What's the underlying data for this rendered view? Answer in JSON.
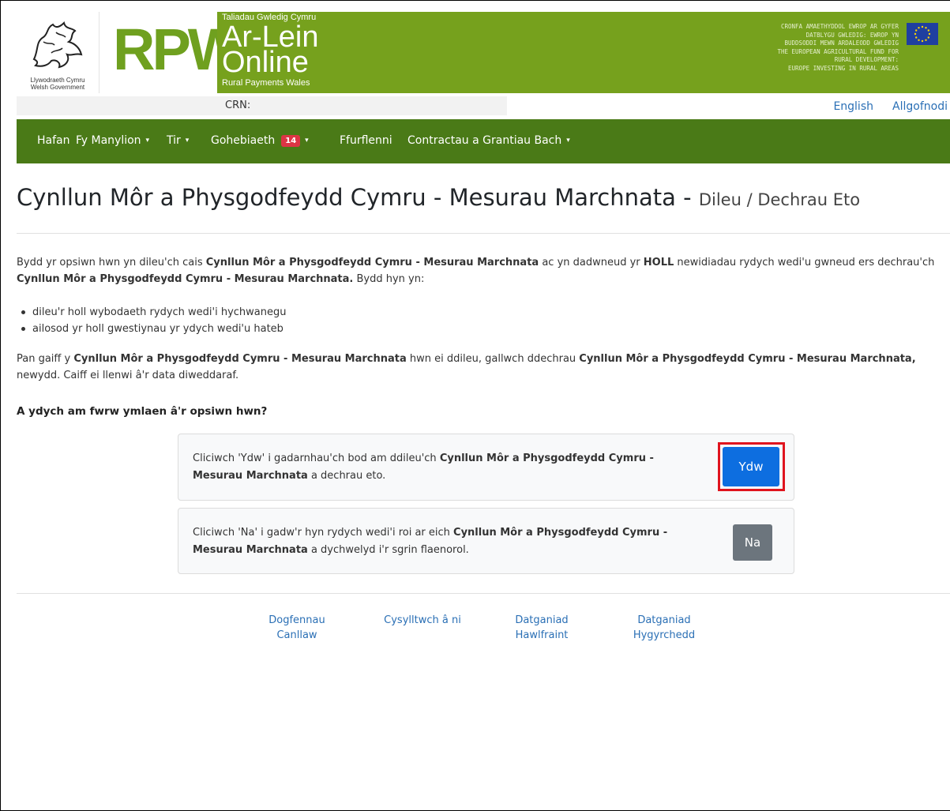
{
  "header": {
    "gov_logo_welsh": "Llywodraeth Cymru",
    "gov_logo_english": "Welsh Government",
    "rpw_logo_text": "RPW",
    "band_small": "Taliadau Gwledig Cymru",
    "band_big_line1": "Ar-Lein",
    "band_big_line2": "Online",
    "band_sub": "Rural Payments Wales",
    "eu_lines": [
      "CRONFA AMAETHYDDOL EWROP AR GYFER",
      "DATBLYGU GWLEDIG: EWROP YN",
      "BUDDSODDI MEWN ARDALEODD GWLEDIG",
      "THE EUROPEAN AGRICULTURAL FUND FOR",
      "RURAL DEVELOPMENT:",
      "EUROPE INVESTING IN RURAL AREAS"
    ],
    "crn_label": "CRN:",
    "lang_link": "English",
    "logout_link": "Allgofnodi"
  },
  "nav": {
    "items": [
      {
        "label": "Hafan"
      },
      {
        "label": "Fy Manylion",
        "caret": "▾"
      },
      {
        "label": "Tir",
        "caret": "▾"
      },
      {
        "label": "Gohebiaeth",
        "badge": "14",
        "caret": "▾"
      },
      {
        "label": "Ffurflenni"
      },
      {
        "label": "Contractau a Grantiau Bach",
        "caret": "▾"
      }
    ]
  },
  "page": {
    "title_main": "Cynllun Môr a Physgodfeydd Cymru - Mesurau Marchnata - ",
    "title_sub": "Dileu / Dechrau Eto",
    "scheme_name": "Cynllun Môr a Physgodfeydd Cymru - Mesurau Marchnata",
    "intro_1": "Bydd yr opsiwn hwn yn dileu'ch cais ",
    "intro_2": " ac yn dadwneud yr ",
    "intro_holl": "HOLL",
    "intro_3": " newidiadau rydych wedi'u gwneud ers dechrau'ch ",
    "intro_scheme_end": "Cynllun Môr a Physgodfeydd Cymru - Mesurau Marchnata.",
    "intro_4": " Bydd hyn yn:",
    "bullets": [
      "dileu'r holl wybodaeth rydych wedi'i hychwanegu",
      "ailosod yr holl gwestiynau yr ydych wedi'u hateb"
    ],
    "after_1": "Pan gaiff y ",
    "after_2": " hwn ei ddileu, gallwch ddechrau ",
    "after_scheme_end": "Cynllun Môr a Physgodfeydd Cymru - Mesurau Marchnata,",
    "after_3": " newydd. Caiff ei llenwi â'r data diweddaraf.",
    "question": "A ydych am fwrw ymlaen â'r opsiwn hwn?",
    "yes_text_1": "Cliciwch 'Ydw' i gadarnhau'ch bod am ddileu'ch ",
    "yes_text_scheme": "Cynllun Môr a Physgodfeydd Cymru - Mesurau Marchnata",
    "yes_text_2": " a dechrau eto.",
    "yes_button": "Ydw",
    "no_text_1": "Cliciwch 'Na' i gadw'r hyn rydych wedi'i roi ar eich ",
    "no_text_scheme": "Cynllun Môr a Physgodfeydd Cymru - Mesurau Marchnata",
    "no_text_2": " a dychwelyd i'r sgrin flaenorol.",
    "no_button": "Na"
  },
  "footer": {
    "links": [
      {
        "line1": "Dogfennau",
        "line2": "Canllaw"
      },
      {
        "line1": "Cysylltwch â ni",
        "line2": ""
      },
      {
        "line1": "Datganiad",
        "line2": "Hawlfraint"
      },
      {
        "line1": "Datganiad",
        "line2": "Hygyrchedd"
      }
    ]
  },
  "colors": {
    "header_green": "#76a11d",
    "nav_green": "#4a7a17",
    "primary_button": "#0d6ee0",
    "secondary_button": "#6c757d",
    "highlight_red": "#e0141e",
    "badge_red": "#dc3545",
    "link_blue": "#2a6fb5"
  }
}
